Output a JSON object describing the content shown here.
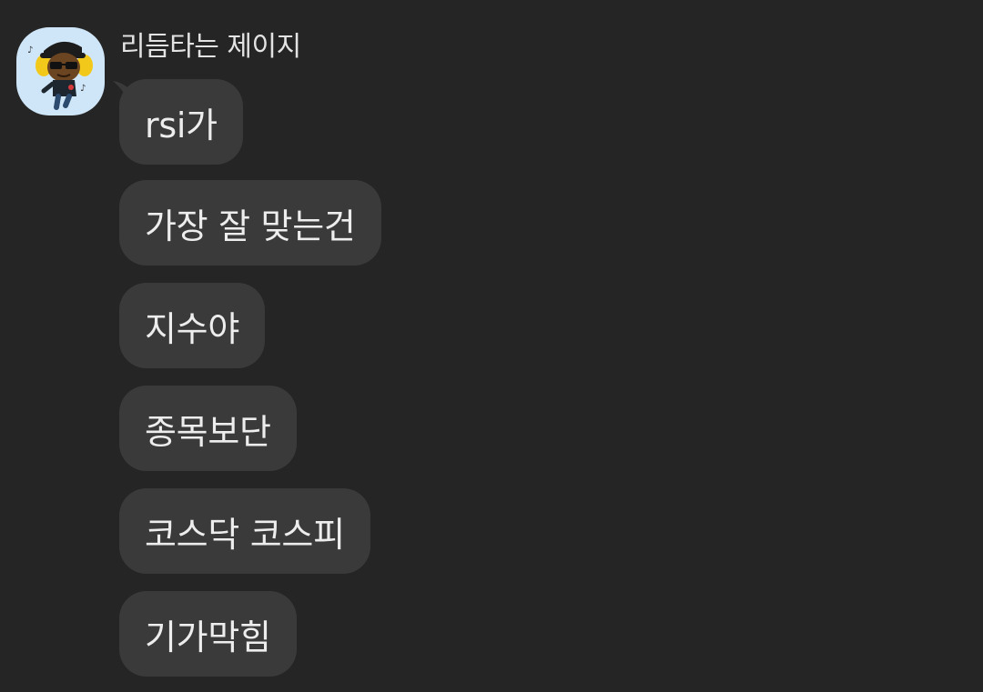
{
  "sender": {
    "name": "리듬타는 제이지",
    "avatar_icon": "character-avatar-icon"
  },
  "messages": [
    {
      "text": "rsi가"
    },
    {
      "text": "가장 잘 맞는건"
    },
    {
      "text": "지수야"
    },
    {
      "text": "종목보단"
    },
    {
      "text": "코스닥 코스피"
    },
    {
      "text": "기가막힘"
    }
  ],
  "colors": {
    "background": "#252525",
    "bubble": "#3a3a3a",
    "text": "#ededed",
    "avatar_bg": "#cfe6f8"
  }
}
